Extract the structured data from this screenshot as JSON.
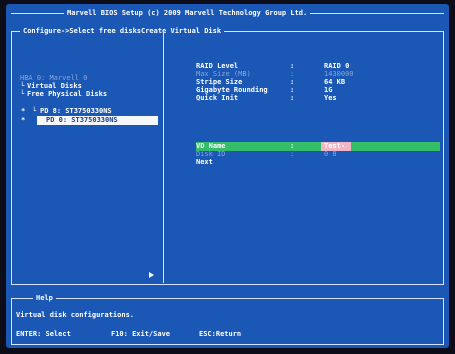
{
  "header": {
    "title": "Marvell BIOS Setup (c) 2009 Marvell Technology Group Ltd."
  },
  "breadcrumb": "Configure->Select free disksCreate Virtual Disk",
  "tree": {
    "hba": "HBA 0: Marvell 0",
    "virtual_disks": "Virtual Disks",
    "free_disks": "Free Physical Disks",
    "pd8": "PD 8: ST3750330NS",
    "pd0": "PD 0: ST3750330NS",
    "pd8_marker": "*",
    "pd0_marker": "*"
  },
  "settings": [
    {
      "label": "RAID Level",
      "value": "RAID 0"
    },
    {
      "label": "Max Size (MB)",
      "value": "1430000"
    },
    {
      "label": "Stripe Size",
      "value": "64 KB"
    },
    {
      "label": "Gigabyte Rounding",
      "value": "1G"
    },
    {
      "label": "Quick Init",
      "value": "Yes"
    },
    {
      "label": "VD Name",
      "value": "Test-"
    },
    {
      "label": "Disk ID",
      "value": "0 8"
    },
    {
      "label": "Next",
      "value": ""
    }
  ],
  "separator": ":",
  "help": {
    "title": "Help",
    "text": "Virtual disk configurations.",
    "keys": [
      {
        "label": "ENTER: Select"
      },
      {
        "label": "F10: Exit/Save"
      },
      {
        "label": "ESC:Return"
      }
    ]
  }
}
